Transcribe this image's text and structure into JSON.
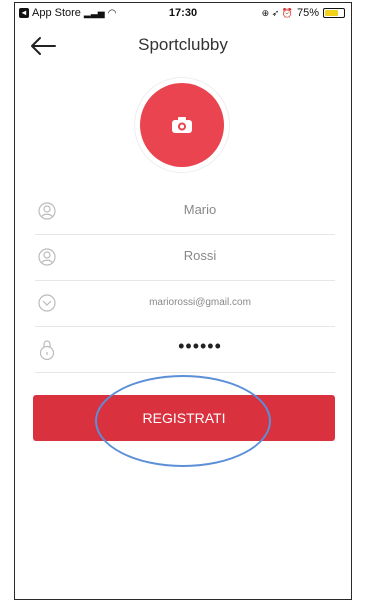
{
  "status_bar": {
    "carrier": "App Store",
    "time": "17:30",
    "battery": "75%",
    "battery_level": 0.75
  },
  "nav": {
    "title": "Sportclubby"
  },
  "form": {
    "first_name": "Mario",
    "last_name": "Rossi",
    "email": "mariorossi@gmail.com",
    "password_mask": "••••••"
  },
  "register_button": {
    "label": "REGISTRATI"
  },
  "colors": {
    "accent": "#e9444f",
    "button": "#d9313e",
    "annotation": "#5b8fd8"
  }
}
